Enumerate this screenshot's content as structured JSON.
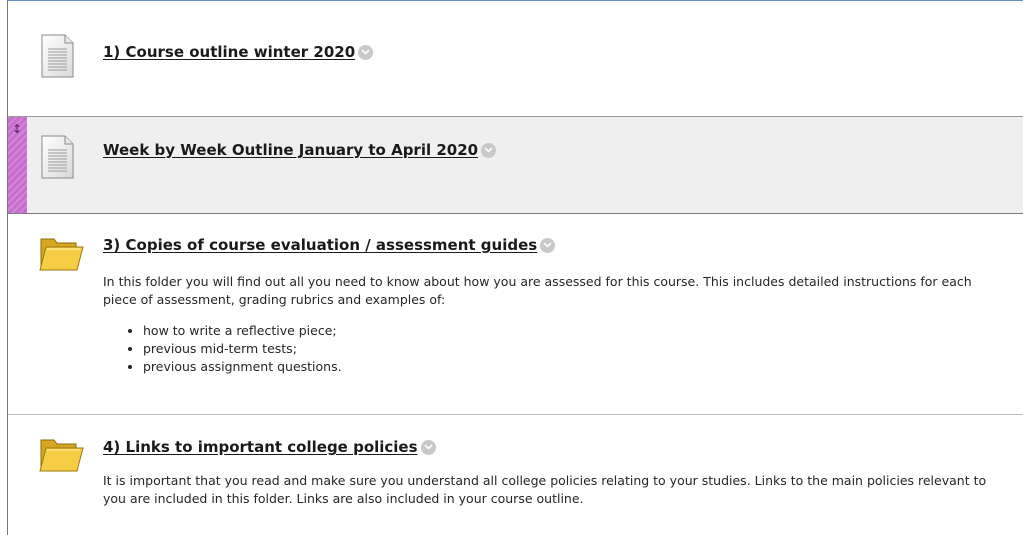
{
  "items": [
    {
      "icon": "document-icon",
      "title": "1) Course outline winter 2020"
    },
    {
      "icon": "document-icon",
      "title": "Week by Week Outline January to April 2020",
      "drag_handle_icon": "drag-arrows-icon"
    },
    {
      "icon": "folder-icon",
      "title": "3) Copies of course evaluation / assessment guides",
      "description": "In this folder you will find out all you need to know about how you are assessed for this course. This includes detailed instructions for each piece of assessment, grading rubrics and examples of:",
      "bullets": [
        "how to write a reflective piece;",
        "previous mid-term tests;",
        "previous assignment questions."
      ]
    },
    {
      "icon": "folder-icon",
      "title": "4) Links to important college policies",
      "description": "It is important that you read and make sure you understand all college policies relating to your studies. Links to the main policies relevant to you are included in this folder. Links are also included in your course outline."
    }
  ],
  "colors": {
    "drag_handle": "#c86ccf",
    "highlight_bg": "#efefef",
    "folder": "#f2c53d",
    "menu_button": "#c9c9c9"
  }
}
